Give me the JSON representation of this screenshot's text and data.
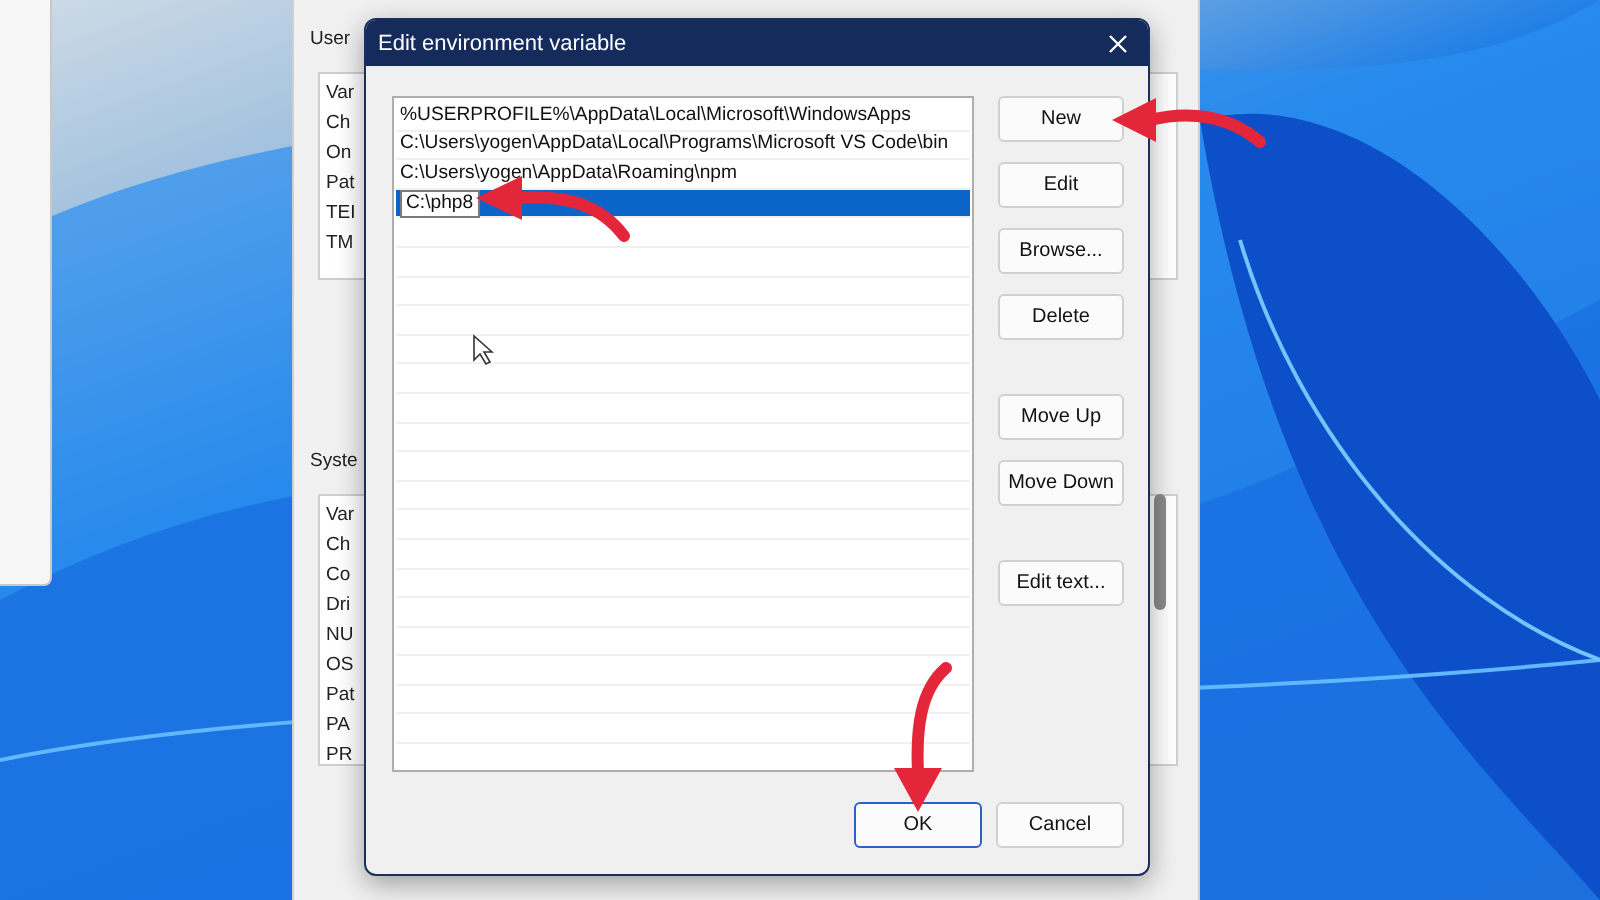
{
  "background_window": {
    "user_section_label": "User",
    "user_list": {
      "header": "Var",
      "rows": [
        "Ch",
        "On",
        "Pat",
        "TEI",
        "TM"
      ]
    },
    "system_section_label": "Syste",
    "system_list": {
      "header": "Var",
      "rows": [
        "Ch",
        "Co",
        "Dri",
        "NU",
        "OS",
        "Pat",
        "PA",
        "PR"
      ]
    }
  },
  "dialog": {
    "title": "Edit environment variable",
    "entries": [
      {
        "text": "%USERPROFILE%\\AppData\\Local\\Microsoft\\WindowsApps",
        "selected": false
      },
      {
        "text": "C:\\Users\\yogen\\AppData\\Local\\Programs\\Microsoft VS Code\\bin",
        "selected": false
      },
      {
        "text": "C:\\Users\\yogen\\AppData\\Roaming\\npm",
        "selected": false
      },
      {
        "text": "C:\\php8",
        "selected": true
      }
    ],
    "button_groups": [
      [
        "New",
        "Edit",
        "Browse...",
        "Delete"
      ],
      [
        "Move Up",
        "Move Down"
      ],
      [
        "Edit text..."
      ]
    ],
    "footer_buttons": [
      {
        "label": "OK",
        "default": true
      },
      {
        "label": "Cancel",
        "default": false
      }
    ]
  }
}
